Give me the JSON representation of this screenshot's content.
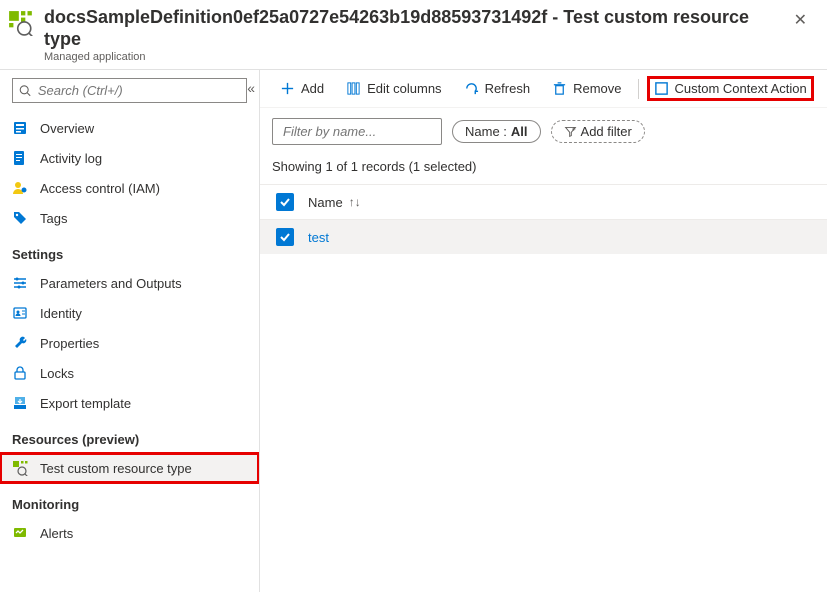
{
  "header": {
    "title": "docsSampleDefinition0ef25a0727e54263b19d88593731492f - Test custom resource type",
    "subtitle": "Managed application"
  },
  "search": {
    "placeholder": "Search (Ctrl+/)"
  },
  "nav": {
    "items": [
      {
        "label": "Overview"
      },
      {
        "label": "Activity log"
      },
      {
        "label": "Access control (IAM)"
      },
      {
        "label": "Tags"
      }
    ],
    "settings_head": "Settings",
    "settings": [
      {
        "label": "Parameters and Outputs"
      },
      {
        "label": "Identity"
      },
      {
        "label": "Properties"
      },
      {
        "label": "Locks"
      },
      {
        "label": "Export template"
      }
    ],
    "resources_head": "Resources (preview)",
    "resources": [
      {
        "label": "Test custom resource type"
      }
    ],
    "monitoring_head": "Monitoring",
    "monitoring": [
      {
        "label": "Alerts"
      }
    ]
  },
  "toolbar": {
    "add": "Add",
    "edit_columns": "Edit columns",
    "refresh": "Refresh",
    "remove": "Remove",
    "custom_action": "Custom Context Action"
  },
  "filter": {
    "placeholder": "Filter by name...",
    "name_label": "Name :",
    "name_value": "All",
    "add_filter": "Add filter"
  },
  "status": "Showing 1 of 1 records (1 selected)",
  "table": {
    "col_name": "Name",
    "rows": [
      {
        "name": "test"
      }
    ]
  }
}
